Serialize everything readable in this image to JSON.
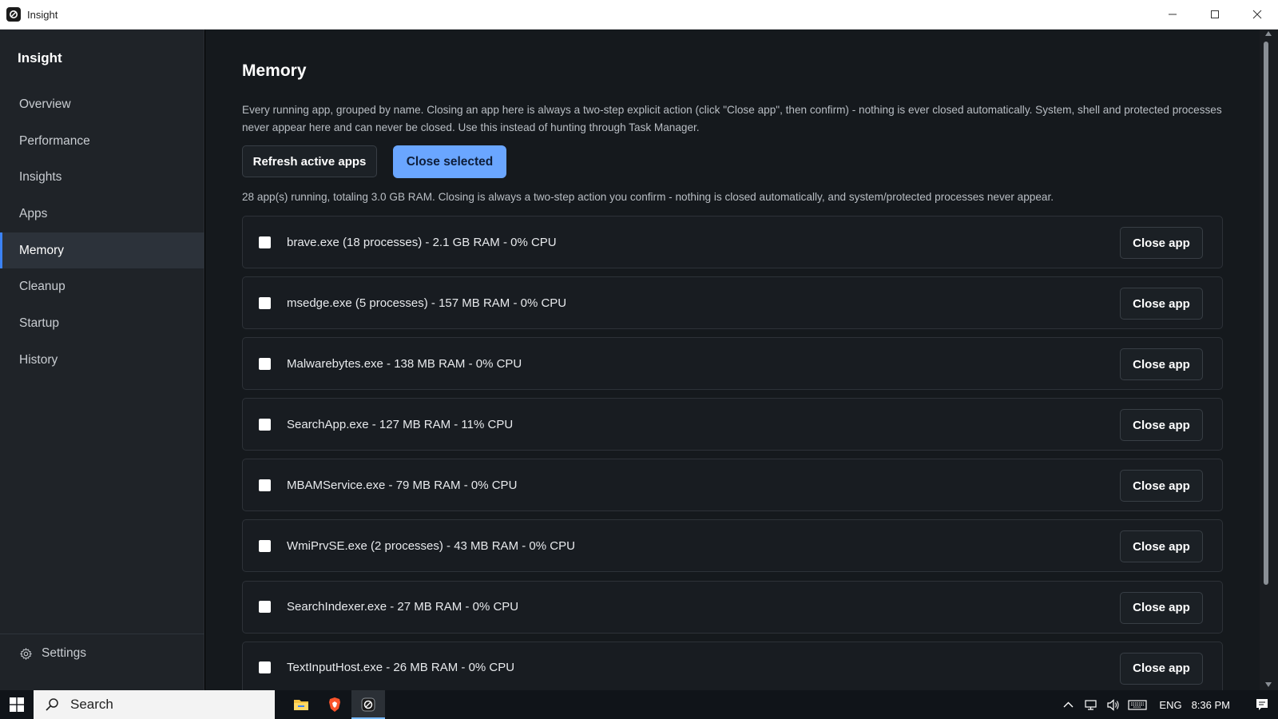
{
  "window": {
    "title": "Insight"
  },
  "sidebar": {
    "brand": "Insight",
    "items": [
      {
        "label": "Overview"
      },
      {
        "label": "Performance"
      },
      {
        "label": "Insights"
      },
      {
        "label": "Apps"
      },
      {
        "label": "Memory"
      },
      {
        "label": "Cleanup"
      },
      {
        "label": "Startup"
      },
      {
        "label": "History"
      }
    ],
    "active_item": "Memory",
    "settings_label": "Settings"
  },
  "main": {
    "title": "Memory",
    "description": "Every running app, grouped by name. Closing an app here is always a two-step explicit action (click \"Close app\", then confirm) - nothing is ever closed automatically. System, shell and protected processes never appear here and can never be closed. Use this instead of hunting through Task Manager.",
    "refresh_label": "Refresh active apps",
    "close_selected_label": "Close selected",
    "summary": "28 app(s) running, totaling 3.0 GB RAM. Closing is always a two-step action you confirm - nothing is closed automatically, and system/protected processes never appear.",
    "close_app_label": "Close app",
    "apps": [
      {
        "label": "brave.exe (18 processes) - 2.1 GB RAM - 0% CPU"
      },
      {
        "label": "msedge.exe (5 processes) - 157 MB RAM - 0% CPU"
      },
      {
        "label": "Malwarebytes.exe - 138 MB RAM - 0% CPU"
      },
      {
        "label": "SearchApp.exe - 127 MB RAM - 11% CPU"
      },
      {
        "label": "MBAMService.exe - 79 MB RAM - 0% CPU"
      },
      {
        "label": "WmiPrvSE.exe (2 processes) - 43 MB RAM - 0% CPU"
      },
      {
        "label": "SearchIndexer.exe - 27 MB RAM - 0% CPU"
      },
      {
        "label": "TextInputHost.exe - 26 MB RAM - 0% CPU"
      }
    ]
  },
  "taskbar": {
    "search_placeholder": "Search",
    "language": "ENG",
    "time": "8:36 PM"
  },
  "icons": {
    "app": "insight-logo-icon",
    "minimize": "minimize-icon",
    "maximize": "maximize-icon",
    "close": "close-icon",
    "settings": "gear-icon",
    "start": "windows-start-icon",
    "search": "search-icon",
    "explorer": "file-explorer-icon",
    "brave": "brave-browser-icon",
    "insight_taskbar": "insight-taskbar-icon",
    "tray_chevron": "chevron-up-icon",
    "network": "network-icon",
    "volume": "volume-icon",
    "keyboard": "keyboard-icon",
    "notifications": "notification-icon"
  },
  "colors": {
    "accent": "#6aa6ff",
    "sidebar_bg": "#1f2328",
    "main_bg": "#15191d",
    "active_indicator": "#3b82f6"
  }
}
